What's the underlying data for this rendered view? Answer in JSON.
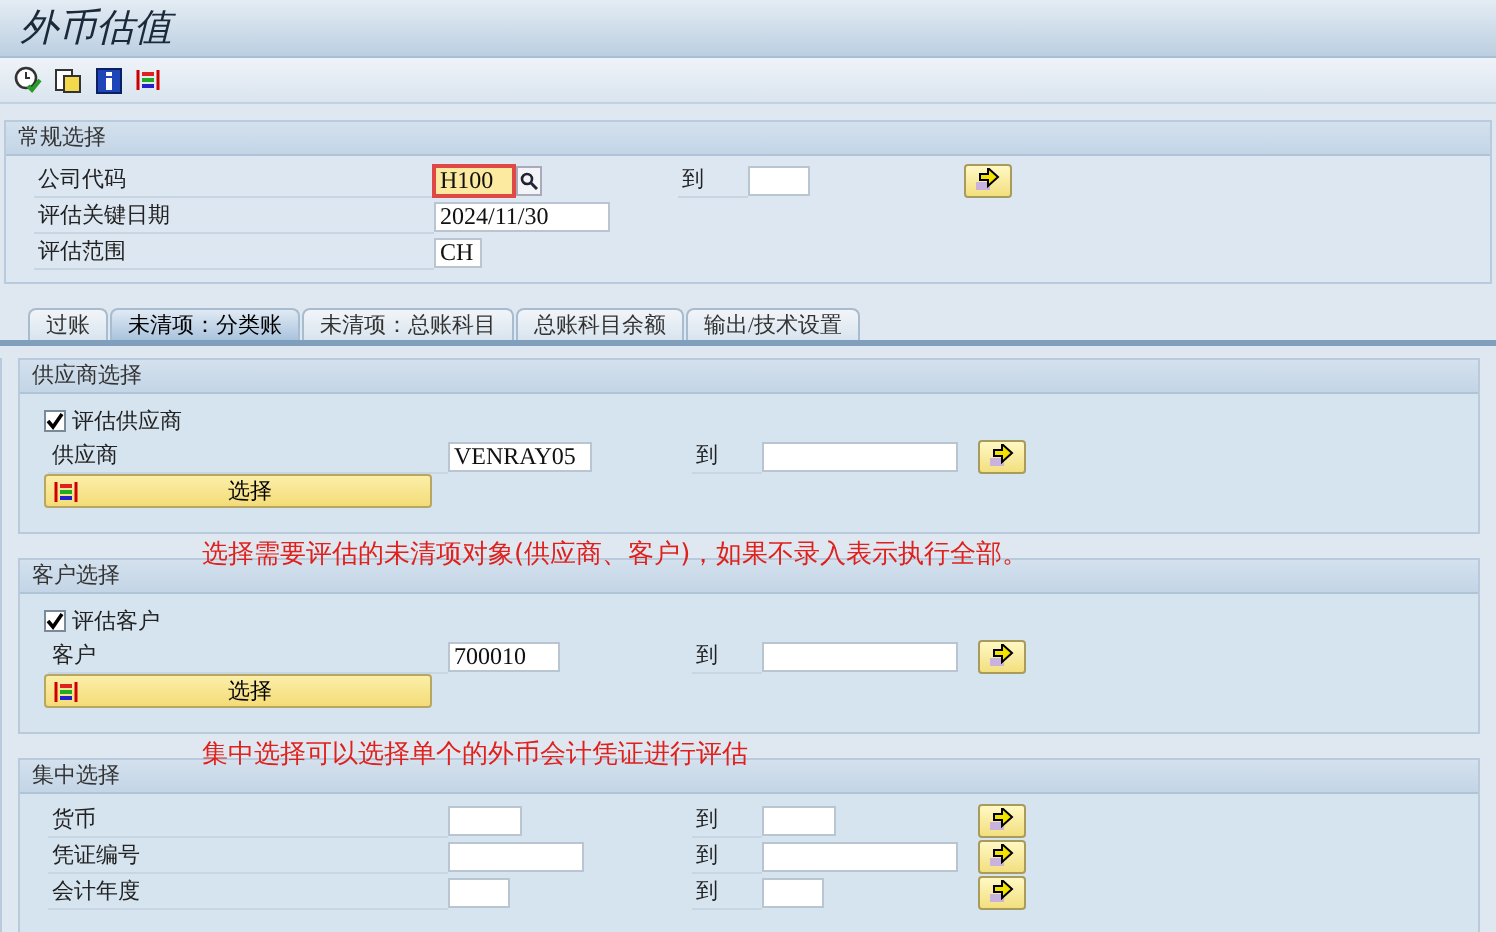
{
  "title": "外币估值",
  "general": {
    "heading": "常规选择",
    "rows": [
      {
        "label": "公司代码",
        "value": "H100",
        "focused": true,
        "search_help": true,
        "to_label": "到"
      },
      {
        "label": "评估关键日期",
        "value": "2024/11/30"
      },
      {
        "label": "评估范围",
        "value": "CH"
      }
    ]
  },
  "tabs": [
    {
      "label": "过账",
      "selected": false
    },
    {
      "label": "未清项：分类账",
      "selected": true
    },
    {
      "label": "未清项：总账科目",
      "selected": false
    },
    {
      "label": "总账科目余额",
      "selected": false
    },
    {
      "label": "输出/技术设置",
      "selected": false
    }
  ],
  "groups": [
    {
      "heading": "供应商选择",
      "checkbox": {
        "label": "评估供应商",
        "checked": true
      },
      "rows": [
        {
          "label": "供应商",
          "value": "VENRAY05",
          "to_label": "到"
        }
      ],
      "select_button": "选择"
    },
    {
      "note_before": "选择需要评估的未清项对象(供应商、客户)，如果不录入表示执行全部。",
      "heading": "客户选择",
      "checkbox": {
        "label": "评估客户",
        "checked": true
      },
      "rows": [
        {
          "label": "客户",
          "value": "700010",
          "to_label": "到"
        }
      ],
      "select_button": "选择"
    },
    {
      "note_before": "集中选择可以选择单个的外币会计凭证进行评估",
      "heading": "集中选择",
      "rows": [
        {
          "label": "货币",
          "to_label": "到"
        },
        {
          "label": "凭证编号",
          "to_label": "到"
        },
        {
          "label": "会计年度",
          "to_label": "到"
        }
      ]
    }
  ]
}
